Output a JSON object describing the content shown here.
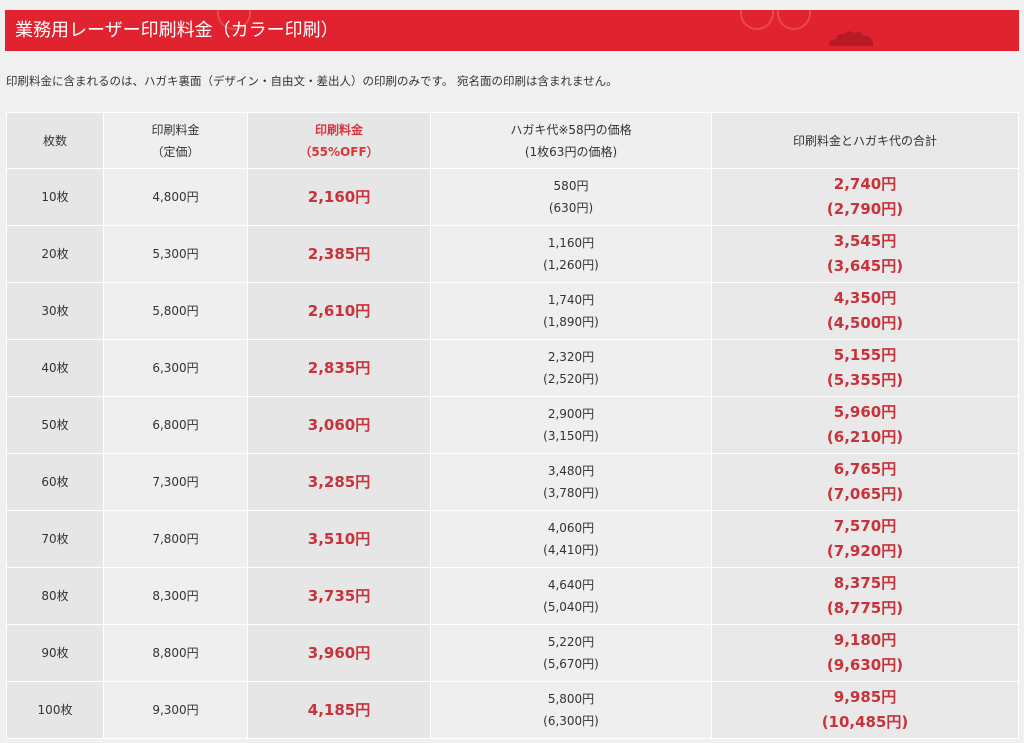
{
  "header": {
    "title": "業務用レーザー印刷料金（カラー印刷）",
    "accent_color": "#e0232f"
  },
  "notice": "印刷料金に含まれるのは、ハガキ裏面（デザイン・自由文・差出人）の印刷のみです。 宛名面の印刷は含まれません。",
  "table": {
    "headers": {
      "qty": "枚数",
      "list_price_line1": "印刷料金",
      "list_price_line2": "（定価）",
      "discount_line1": "印刷料金",
      "discount_line2": "（55%OFF）",
      "postcard_line1": "ハガキ代※58円の価格",
      "postcard_line2": "(1枚63円の価格)",
      "total": "印刷料金とハガキ代の合計"
    },
    "rows": [
      {
        "qty": "10枚",
        "list_price": "4,800円",
        "discount_price": "2,160円",
        "postcard_58": "580円",
        "postcard_63": "(630円)",
        "total_58": "2,740円",
        "total_63": "(2,790円)"
      },
      {
        "qty": "20枚",
        "list_price": "5,300円",
        "discount_price": "2,385円",
        "postcard_58": "1,160円",
        "postcard_63": "(1,260円)",
        "total_58": "3,545円",
        "total_63": "(3,645円)"
      },
      {
        "qty": "30枚",
        "list_price": "5,800円",
        "discount_price": "2,610円",
        "postcard_58": "1,740円",
        "postcard_63": "(1,890円)",
        "total_58": "4,350円",
        "total_63": "(4,500円)"
      },
      {
        "qty": "40枚",
        "list_price": "6,300円",
        "discount_price": "2,835円",
        "postcard_58": "2,320円",
        "postcard_63": "(2,520円)",
        "total_58": "5,155円",
        "total_63": "(5,355円)"
      },
      {
        "qty": "50枚",
        "list_price": "6,800円",
        "discount_price": "3,060円",
        "postcard_58": "2,900円",
        "postcard_63": "(3,150円)",
        "total_58": "5,960円",
        "total_63": "(6,210円)"
      },
      {
        "qty": "60枚",
        "list_price": "7,300円",
        "discount_price": "3,285円",
        "postcard_58": "3,480円",
        "postcard_63": "(3,780円)",
        "total_58": "6,765円",
        "total_63": "(7,065円)"
      },
      {
        "qty": "70枚",
        "list_price": "7,800円",
        "discount_price": "3,510円",
        "postcard_58": "4,060円",
        "postcard_63": "(4,410円)",
        "total_58": "7,570円",
        "total_63": "(7,920円)"
      },
      {
        "qty": "80枚",
        "list_price": "8,300円",
        "discount_price": "3,735円",
        "postcard_58": "4,640円",
        "postcard_63": "(5,040円)",
        "total_58": "8,375円",
        "total_63": "(8,775円)"
      },
      {
        "qty": "90枚",
        "list_price": "8,800円",
        "discount_price": "3,960円",
        "postcard_58": "5,220円",
        "postcard_63": "(5,670円)",
        "total_58": "9,180円",
        "total_63": "(9,630円)"
      },
      {
        "qty": "100枚",
        "list_price": "9,300円",
        "discount_price": "4,185円",
        "postcard_58": "5,800円",
        "postcard_63": "(6,300円)",
        "total_58": "9,985円",
        "total_63": "(10,485円)"
      }
    ]
  },
  "colors": {
    "price_red": "#c8323a",
    "page_background": "#f0f0f0"
  }
}
